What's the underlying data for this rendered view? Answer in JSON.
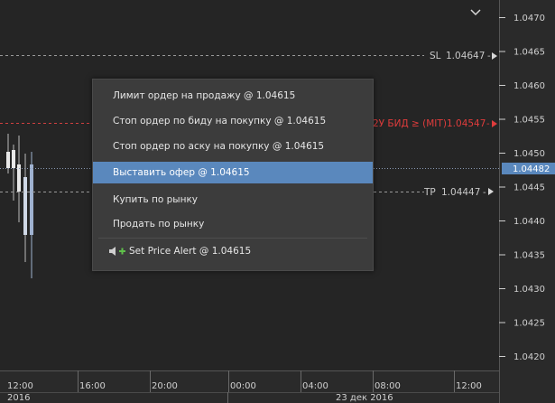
{
  "price_axis": {
    "ticks": [
      "1.0470",
      "1.0465",
      "1.0460",
      "1.0455",
      "1.0450",
      "1.0445",
      "1.0440",
      "1.0435",
      "1.0430",
      "1.0425",
      "1.0420"
    ],
    "current_price": "1.04482",
    "current_price_color": "#5a88bd"
  },
  "time_axis": {
    "ticks": [
      "12:00",
      "16:00",
      "20:00",
      "00:00",
      "04:00",
      "08:00",
      "12:00"
    ],
    "date_labels": [
      "2016",
      "23 дек 2016"
    ]
  },
  "order_lines": {
    "sl": {
      "tag": "SL",
      "price": "1.04647",
      "color": "#c8c8c8"
    },
    "mit": {
      "text": "2У БИД ≥ (MIT)",
      "price": "1.04547",
      "color": "#e03c3c"
    },
    "tp": {
      "tag": "TP",
      "price": "1.04447",
      "color": "#c8c8c8"
    }
  },
  "context_menu": {
    "items": [
      "Лимит ордер на продажу @ 1.04615",
      "Стоп ордер по биду на покупку @ 1.04615",
      "Стоп ордер по аску на покупку @ 1.04615",
      "Выставить офер @ 1.04615",
      "Купить по рынку",
      "Продать по рынку",
      "Set Price Alert @ 1.04615"
    ],
    "selected_index": 3,
    "alert_icon": "speaker-plus-icon",
    "accent": "#5a88bd"
  }
}
